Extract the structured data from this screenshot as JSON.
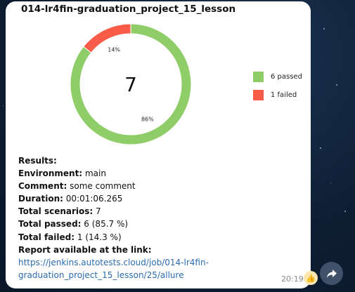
{
  "message": {
    "time": "20:19",
    "reaction": "👍"
  },
  "chart_data": {
    "type": "pie",
    "title": "014-lr4fin-graduation_project_15_lesson",
    "center_label": "7",
    "slices": [
      {
        "label": "6 passed",
        "value": 6,
        "percent_label": "86%",
        "color": "#8fcd68"
      },
      {
        "label": "1 failed",
        "value": 1,
        "percent_label": "14%",
        "color": "#f85c48"
      }
    ],
    "donut": true,
    "legend_position": "right"
  },
  "results": {
    "heading": "Results:",
    "environment_label": "Environment:",
    "environment_value": "main",
    "comment_label": "Comment:",
    "comment_value": "some comment",
    "duration_label": "Duration:",
    "duration_value": "00:01:06.265",
    "total_scenarios_label": "Total scenarios:",
    "total_scenarios_value": "7",
    "total_passed_label": "Total passed:",
    "total_passed_value": "6 (85.7 %)",
    "total_failed_label": "Total failed:",
    "total_failed_value": "1 (14.3 %)",
    "report_label": "Report available at the link:",
    "link_line1": "https://jenkins.autotests.cloud/job/014-lr4fin-",
    "link_line2": "graduation_project_15_lesson/25/allure"
  },
  "icons": {
    "forward": "forward-arrow-icon",
    "reaction": "thumbs-up-icon"
  }
}
